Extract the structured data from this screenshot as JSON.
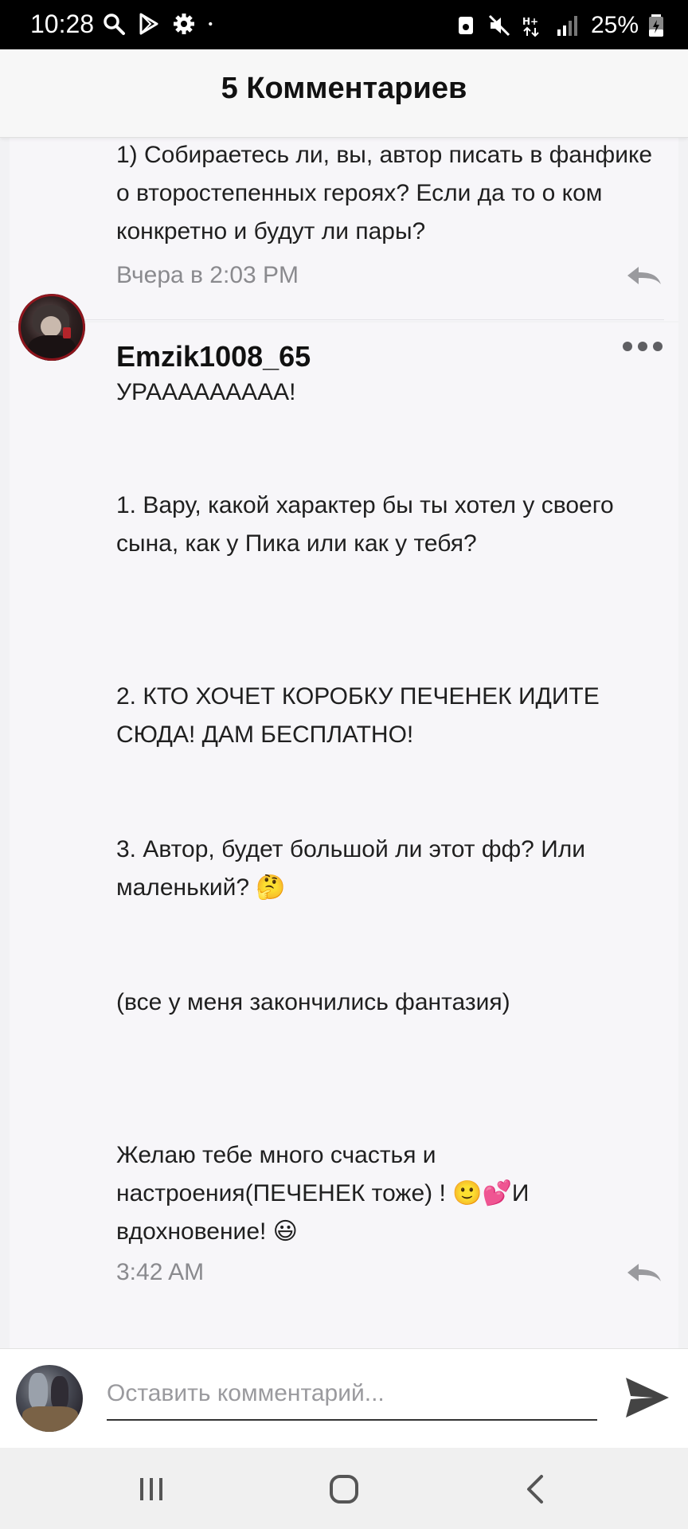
{
  "status_bar": {
    "time": "10:28",
    "battery": "25%",
    "left_icons": [
      "search-icon",
      "play-store-icon",
      "settings-icon",
      "dot-icon"
    ],
    "right_icons": [
      "screen-share-icon",
      "mute-icon",
      "network-ht-icon",
      "signal-icon",
      "battery-icon"
    ]
  },
  "header": {
    "title": "5 Комментариев"
  },
  "comments": [
    {
      "text": "1) Собираетесь ли, вы, автор писать в фанфике о второстепенных героях? Если да то о ком конкретно и будут ли пары?",
      "timestamp": "Вчера в 2:03 PM"
    },
    {
      "username": "Emzik1008_65",
      "paragraphs": [
        "УРААААААААА!",
        "1. Вару, какой характер бы ты хотел у своего сына, как у Пика или как у тебя?",
        "2. КТО ХОЧЕТ КОРОБКУ ПЕЧЕНЕК ИДИТЕ СЮДА! ДАМ БЕСПЛАТНО!",
        "3. Автор, будет большой ли этот фф? Или маленький? 🤔",
        "(все у меня закончились фантазия)",
        "Желаю тебе много счастья и настроения(ПЕЧЕНЕК тоже) ! 🙂💕И вдохновение! 😃"
      ],
      "timestamp": "3:42 AM"
    }
  ],
  "input": {
    "placeholder": "Оставить комментарий..."
  },
  "colors": {
    "accent_dark": "#111111",
    "meta_gray": "#8a8a8e",
    "background": "#f2f2f4"
  }
}
